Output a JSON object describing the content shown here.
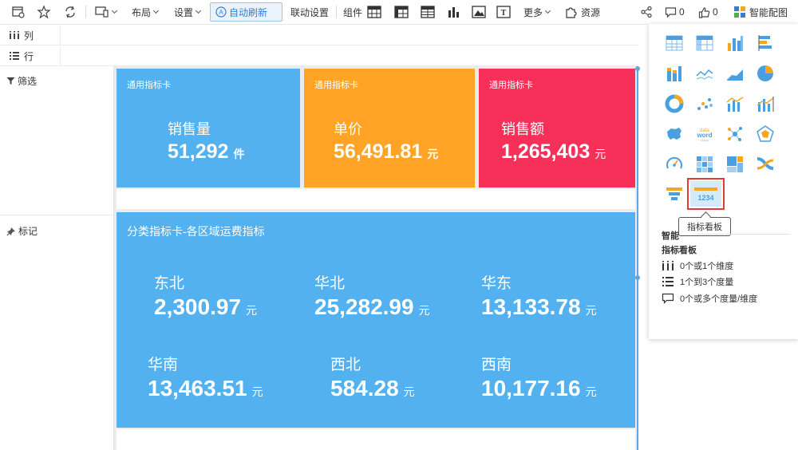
{
  "toolbar": {
    "layout": "布局",
    "settings": "设置",
    "auto_refresh": "自动刷新",
    "linkage": "联动设置",
    "components": "组件",
    "more": "更多",
    "resources": "资源",
    "comments_count": "0",
    "likes_count": "0",
    "smart_chart": "智能配图"
  },
  "fields": {
    "columns": "列",
    "rows": "行",
    "filter": "筛选",
    "mark": "标记"
  },
  "cards": [
    {
      "title": "通用指标卡",
      "name": "销售量",
      "value": "51,292",
      "unit": "件",
      "color": "#52b1ee"
    },
    {
      "title": "通用指标卡",
      "name": "单价",
      "value": "56,491.81",
      "unit": "元",
      "color": "#ffa427"
    },
    {
      "title": "通用指标卡",
      "name": "销售额",
      "value": "1,265,403",
      "unit": "元",
      "color": "#f7305a"
    }
  ],
  "category_card": {
    "title": "分类指标卡-各区域运费指标",
    "color": "#52b1ee",
    "regions": [
      {
        "name": "东北",
        "value": "2,300.97",
        "unit": "元"
      },
      {
        "name": "华北",
        "value": "25,282.99",
        "unit": "元"
      },
      {
        "name": "华东",
        "value": "13,133.78",
        "unit": "元"
      },
      {
        "name": "华南",
        "value": "13,463.51",
        "unit": "元"
      },
      {
        "name": "西北",
        "value": "584.28",
        "unit": "元"
      },
      {
        "name": "西南",
        "value": "10,177.16",
        "unit": "元"
      }
    ]
  },
  "chart_picker": {
    "tooltip": "指标看板",
    "section_title": "智能",
    "selected_chart": "指标看板",
    "requirements": [
      "0个或1个维度",
      "1个到3个度量",
      "0个或多个度量/维度"
    ],
    "number_icon_text": "1234",
    "wordcloud_icon_text": "word"
  }
}
